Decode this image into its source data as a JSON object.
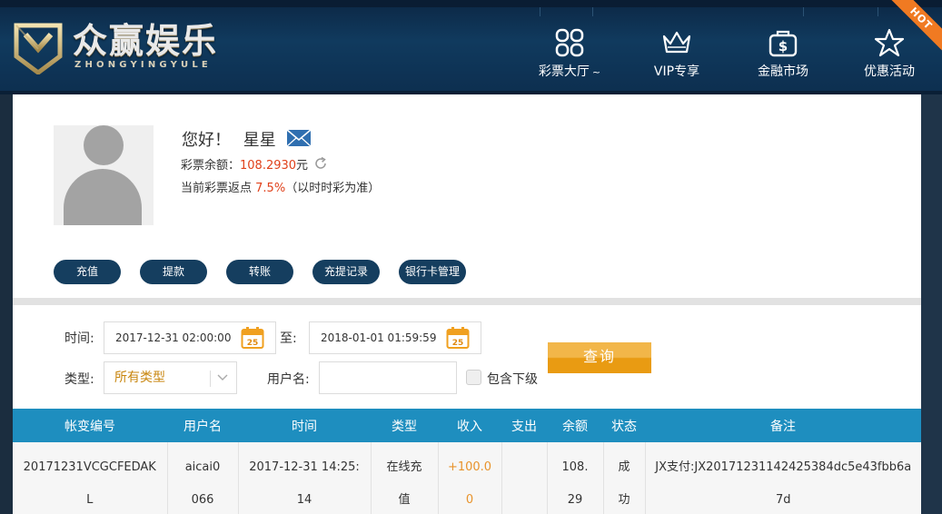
{
  "brand": {
    "name": "众赢娱乐",
    "sub": "ZHONGYINGYULE"
  },
  "nav": {
    "items": [
      {
        "label": "彩票大厅",
        "icon": "grid-icon"
      },
      {
        "label": "VIP专享",
        "icon": "crown-icon"
      },
      {
        "label": "金融市场",
        "icon": "dollar-bag-icon"
      },
      {
        "label": "优惠活动",
        "icon": "star-icon"
      }
    ],
    "hot_badge": "HOT",
    "dropdown_mark": "~"
  },
  "profile": {
    "greeting": "您好！",
    "username": "星星",
    "balance_label": "彩票余额：",
    "balance_value": "108.2930",
    "balance_unit": "元",
    "rebate_label": "当前彩票返点",
    "rebate_value": "7.5%",
    "rebate_note": "（以时时彩为准）"
  },
  "actions": [
    "充值",
    "提款",
    "转账",
    "充提记录",
    "银行卡管理"
  ],
  "filter": {
    "time_label": "时间:",
    "start_time": "2017-12-31 02:00:00",
    "to_label": "至:",
    "end_time": "2018-01-01 01:59:59",
    "calendar_day": "25",
    "type_label": "类型:",
    "type_value": "所有类型",
    "username_label": "用户名:",
    "username_value": "",
    "include_sub_label": "包含下级",
    "query_label": "查询"
  },
  "table": {
    "headers": [
      "帐变编号",
      "用户名",
      "时间",
      "类型",
      "收入",
      "支出",
      "余额",
      "状态",
      "备注"
    ],
    "rows": [
      {
        "id": "20171231VCGCFEDAKL",
        "user": "aicai0066",
        "time": "2017-12-31 14:25:14",
        "type": "在线充值",
        "income": "+100.00",
        "expense": "",
        "balance": "108.29",
        "status": "成功",
        "remark": "JX支付:JX20171231142425384dc5e43fbb6a7d"
      }
    ]
  },
  "colors": {
    "accent_orange": "#e8932b",
    "balance_red": "#e0411b",
    "header_blue": "#1e8ebf",
    "button_navy": "#153e5f"
  }
}
